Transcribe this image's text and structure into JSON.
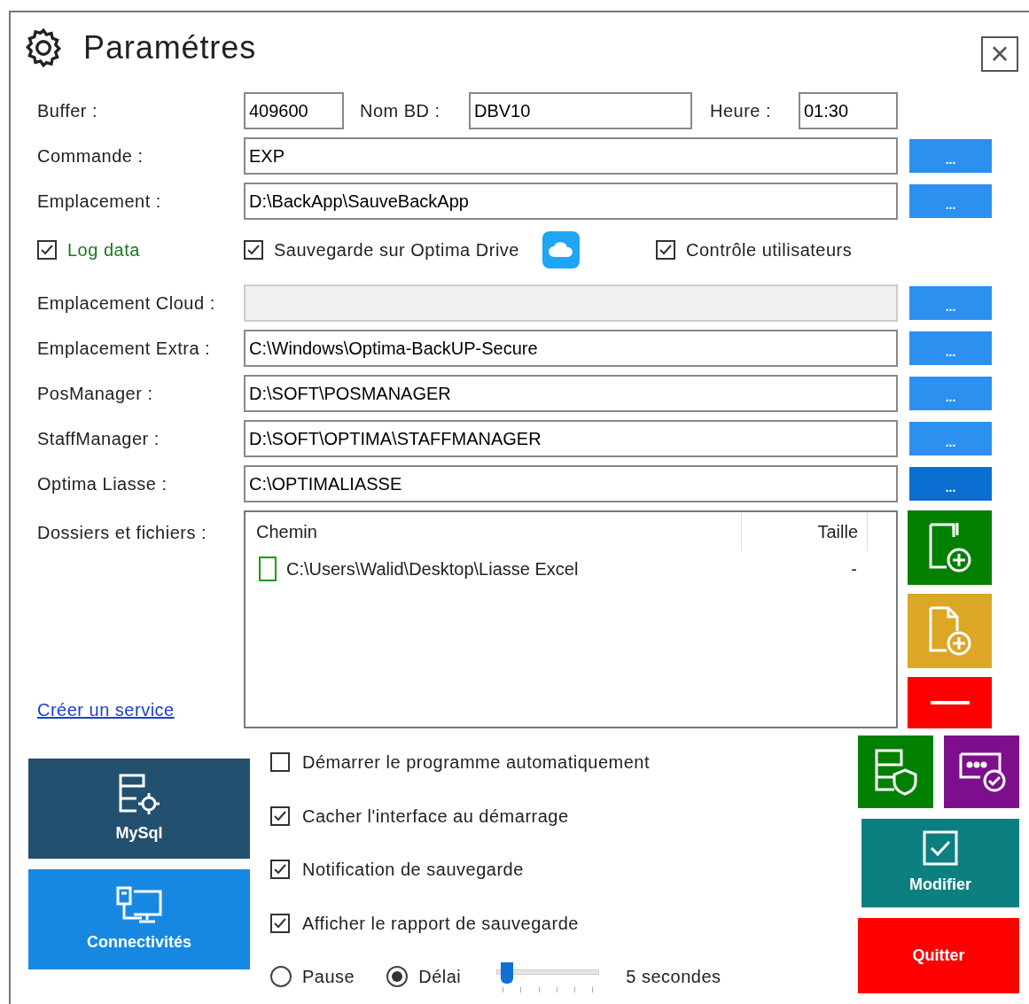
{
  "window": {
    "title": "Paramétres",
    "close": "×"
  },
  "top_row": [
    {
      "label": "Buffer :",
      "value": "409600"
    },
    {
      "label": "Nom BD :",
      "value": "DBV10"
    },
    {
      "label": "Heure :",
      "value": "01:30"
    }
  ],
  "path_rows_a": [
    {
      "label": "Commande :",
      "value": "EXP",
      "button": "...",
      "disabled": false,
      "focused": false
    },
    {
      "label": "Emplacement :",
      "value": "D:\\BackApp\\SauveBackApp",
      "button": "...",
      "disabled": false,
      "focused": false
    }
  ],
  "options": [
    {
      "label": "Log data",
      "checked": true,
      "kind": "green"
    },
    {
      "label": "Sauvegarde sur Optima Drive",
      "checked": true,
      "kind": "cloud"
    },
    {
      "label": "Contrôle utilisateurs",
      "checked": true,
      "kind": "plain"
    }
  ],
  "path_rows_b": [
    {
      "label": "Emplacement Cloud :",
      "button": "...",
      "disabled": true,
      "focused": false
    },
    {
      "label": "Emplacement Extra :",
      "value": "C:\\Windows\\Optima-BackUP-Secure",
      "button": "...",
      "disabled": false,
      "focused": false
    },
    {
      "label": "PosManager :",
      "value": "D:\\SOFT\\POSMANAGER",
      "button": "...",
      "disabled": false,
      "focused": false
    },
    {
      "label": "StaffManager :",
      "value": "D:\\SOFT\\OPTIMA\\STAFFMANAGER",
      "button": "...",
      "disabled": false,
      "focused": false
    },
    {
      "label": "Optima Liasse :",
      "value": "C:\\OPTIMALIASSE",
      "button": "...",
      "disabled": false,
      "focused": true
    }
  ],
  "files": {
    "label": "Dossiers et fichiers :",
    "link": "Créer un service",
    "columns": [
      "Chemin",
      "Taille"
    ],
    "rows": [
      {
        "path": "C:\\Users\\Walid\\Desktop\\Liasse Excel",
        "size": "-"
      }
    ]
  },
  "side_actions": [
    {
      "kind": "add-folder"
    },
    {
      "kind": "add-file"
    },
    {
      "kind": "remove"
    }
  ],
  "big_buttons": [
    {
      "label": "MySql",
      "kind": "database"
    },
    {
      "label": "Connectivités",
      "kind": "network"
    }
  ],
  "startup_options": [
    {
      "label": "Démarrer le programme automatiquement",
      "checked": false
    },
    {
      "label": "Cacher l'interface au démarrage",
      "checked": true
    },
    {
      "label": "Notification de sauvegarde",
      "checked": true
    },
    {
      "label": "Afficher le rapport de sauvegarde",
      "checked": true
    }
  ],
  "mode": [
    {
      "label": "Pause",
      "selected": false
    },
    {
      "label": "Délai",
      "selected": true
    }
  ],
  "delay": {
    "level": 0.05,
    "reading": "5 secondes"
  },
  "tools": [
    {
      "kind": "shield"
    },
    {
      "kind": "message"
    }
  ],
  "modify": "Modifier",
  "quit": "Quitter"
}
